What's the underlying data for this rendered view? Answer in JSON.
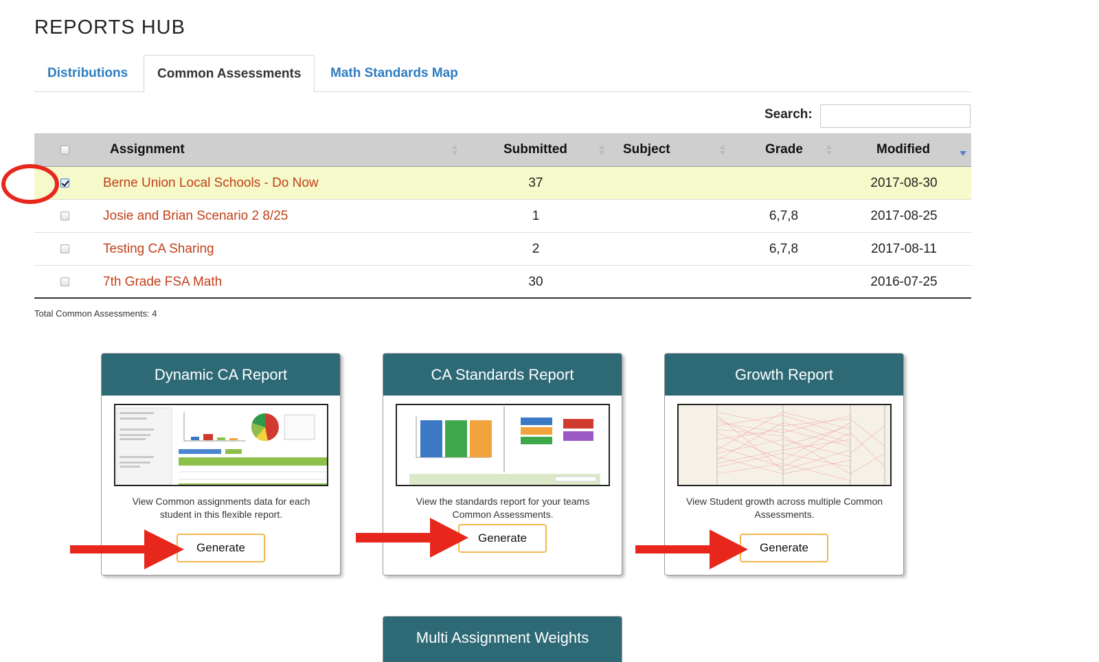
{
  "page": {
    "title": "REPORTS HUB"
  },
  "tabs": [
    {
      "label": "Distributions",
      "active": false
    },
    {
      "label": "Common Assessments",
      "active": true
    },
    {
      "label": "Math Standards Map",
      "active": false
    }
  ],
  "search": {
    "label": "Search:",
    "value": ""
  },
  "table": {
    "columns": [
      "Assignment",
      "Submitted",
      "Subject",
      "Grade",
      "Modified"
    ],
    "sort": {
      "column": "Modified",
      "direction": "desc"
    },
    "rows": [
      {
        "assignment": "Berne Union Local Schools - Do Now",
        "submitted": "37",
        "subject": "",
        "grade": "",
        "modified": "2017-08-30",
        "checked": true
      },
      {
        "assignment": "Josie and Brian Scenario 2 8/25",
        "submitted": "1",
        "subject": "",
        "grade": "6,7,8",
        "modified": "2017-08-25",
        "checked": false
      },
      {
        "assignment": "Testing CA Sharing",
        "submitted": "2",
        "subject": "",
        "grade": "6,7,8",
        "modified": "2017-08-11",
        "checked": false
      },
      {
        "assignment": "7th Grade FSA Math",
        "submitted": "30",
        "subject": "",
        "grade": "",
        "modified": "2016-07-25",
        "checked": false
      }
    ],
    "total_label": "Total Common Assessments: 4"
  },
  "cards": [
    {
      "title": "Dynamic CA Report",
      "description": "View Common assignments data for each student in this flexible report.",
      "button": "Generate"
    },
    {
      "title": "CA Standards Report",
      "description": "View the standards report for your teams Common Assessments.",
      "button": "Generate"
    },
    {
      "title": "Growth Report",
      "description": "View Student growth across multiple Common Assessments.",
      "button": "Generate"
    },
    {
      "title": "Multi Assignment Weights"
    }
  ],
  "colors": {
    "link": "#c1401a",
    "tab_link": "#2e7cc0",
    "card_header": "#2d6a76",
    "selected_row": "#f6f9c9",
    "annotation_red": "#e8271c",
    "button_border": "#f3b74a"
  }
}
